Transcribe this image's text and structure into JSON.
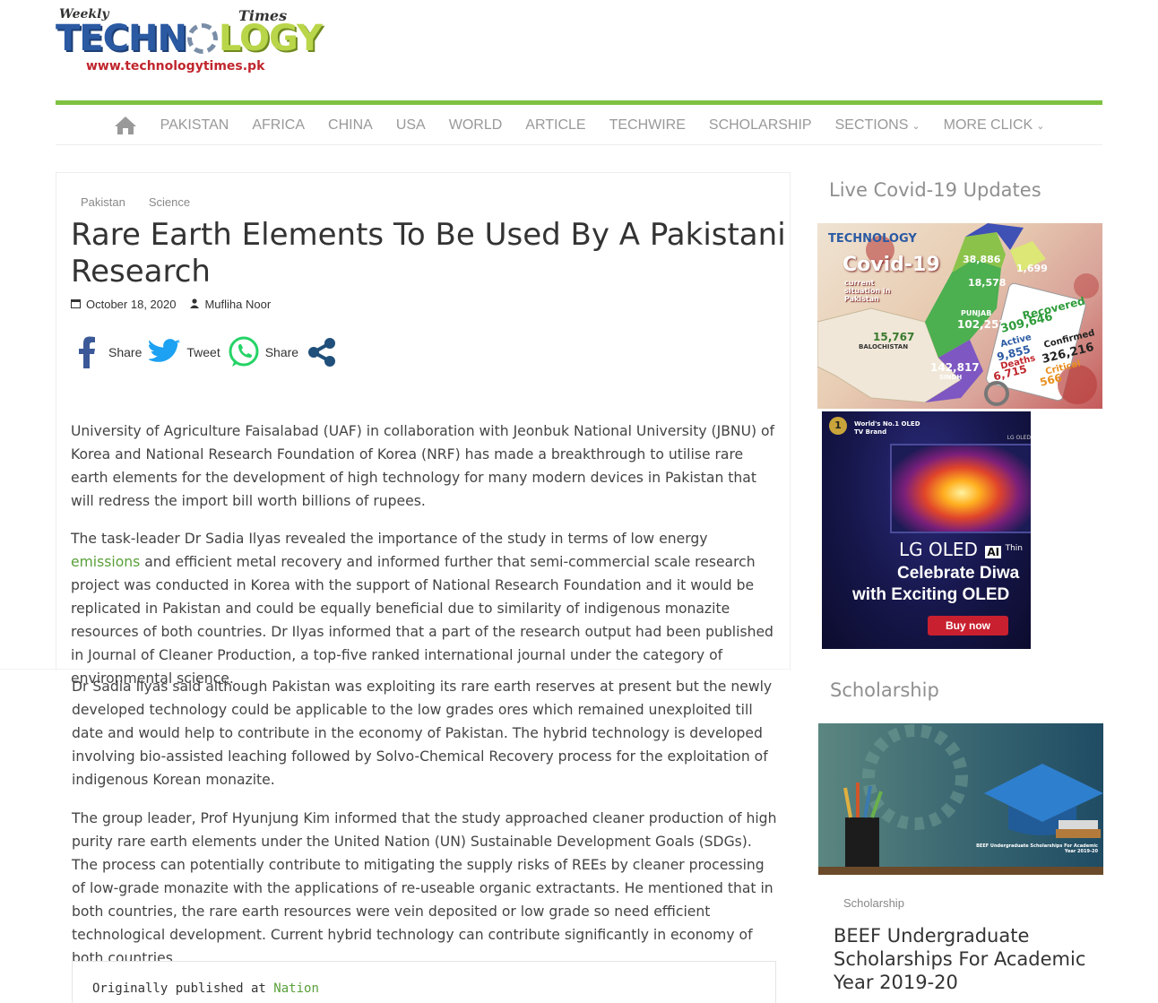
{
  "logo": {
    "weekly": "Weekly",
    "word_start": "TECHN",
    "word_end": "LOGY",
    "times": "Times",
    "url": "www.technologytimes.pk"
  },
  "nav": {
    "items": [
      {
        "label": "PAKISTAN"
      },
      {
        "label": "AFRICA"
      },
      {
        "label": "CHINA"
      },
      {
        "label": "USA"
      },
      {
        "label": "WORLD"
      },
      {
        "label": "ARTICLE"
      },
      {
        "label": "TECHWIRE"
      },
      {
        "label": "SCHOLARSHIP"
      },
      {
        "label": "SECTIONS",
        "caret": "⌄"
      },
      {
        "label": "MORE CLICK",
        "caret": "⌄"
      }
    ]
  },
  "article": {
    "categories": [
      "Pakistan",
      "Science"
    ],
    "title": "Rare Earth Elements To Be Used By A Pakistani Research",
    "date": "October 18, 2020",
    "author": "Mufliha Noor",
    "share": {
      "facebook_label": "Share",
      "twitter_label": "Tweet",
      "whatsapp_label": "Share"
    },
    "p1": "University of Agriculture Faisalabad (UAF) in collaboration with Jeonbuk National University (JBNU) of Korea and National Research Foundation of Korea (NRF) has made a breakthrough to utilise rare earth elements for the development of high technology for many modern devices in Pakistan that will redress the import bill worth billions of rupees.",
    "p2_before": "The task-leader Dr Sadia Ilyas revealed the importance of the study in terms of low energy ",
    "p2_link": "emissions",
    "p2_after": " and efficient metal recovery and informed further that semi-commercial scale research project was conducted in Korea with the support of National Research Foundation and it would be replicated in Pakistan and could be equally beneficial due to similarity of indigenous monazite resources of both countries. Dr Ilyas informed that a part of the research output had been published in Journal of Cleaner Production, a top-five ranked international journal under the category of environmental science.",
    "p3": "Dr Sadia Ilyas said although Pakistan was exploiting its rare earth reserves at present but the newly developed technology could be applicable to the low grades ores which remained unexploited till date and would help to contribute in the economy of Pakistan. The hybrid technology is developed involving bio-assisted leaching followed by Solvo-Chemical Recovery process for the exploitation of indigenous Korean monazite.",
    "p4": "The group leader, Prof Hyunjung Kim informed that the study approached cleaner production of high purity rare earth elements under the United Nation (UN) Sustainable Development Goals (SDGs). The process can potentially contribute to mitigating the supply risks of REEs by cleaner processing of low-grade monazite with the applications of re-useable organic extractants. He mentioned that in both countries, the rare earth resources were vein deposited or low grade so need efficient technological development. Current hybrid technology can contribute significantly in economy of both countries.",
    "published_prefix": "Originally published at ",
    "published_link": "Nation"
  },
  "sidebar": {
    "covid_title": "Live Covid-19 Updates",
    "covid_graphic": {
      "brand": "TECHNOLOGY",
      "headline": "Covid-19",
      "sub": "current situation in Pakistan",
      "recovered": "Recovered",
      "recovered_value": "309,646",
      "active": "Active",
      "active_value": "9,855",
      "deaths": "Deaths",
      "deaths_value": "6,715",
      "confirmed": "Confirmed",
      "confirmed_value": "326,216",
      "critical": "Critical",
      "critical_value": "566",
      "punjab": "PUNJAB",
      "punjab_value": "102,253",
      "sindh": "SINDH",
      "sindh_value": "142,817",
      "balochistan": "BALOCHISTAN",
      "balochistan_value": "15,767",
      "kp_value": "38,886",
      "gb_value": "18,578",
      "ajk_value": "1,699"
    },
    "ad": {
      "badge": "World's No.1 OLED TV Brand",
      "corner": "LG OLED",
      "brand": "LG OLED",
      "ai": "AI",
      "thin": "Thin",
      "line1": "Celebrate Diwa",
      "line2": "with Exciting OLED",
      "cta": "Buy now"
    },
    "scholarship_title": "Scholarship",
    "scholarship_image": {
      "caption": "BEEF Undergraduate Scholarships For Academic Year 2019-20"
    },
    "post": {
      "category": "Scholarship",
      "title": "BEEF Undergraduate Scholarships For Academic Year 2019-20"
    }
  },
  "colors": {
    "accent_green": "#7fc241",
    "link_green": "#5aa03a",
    "logo_blue": "#2b5aa3",
    "logo_red": "#c0262d",
    "facebook": "#3b5998",
    "twitter": "#1da1f2",
    "whatsapp": "#25d366",
    "share_generic": "#1f4f7a"
  },
  "icons": [
    "home-icon",
    "calendar-icon",
    "user-icon",
    "facebook-icon",
    "twitter-icon",
    "whatsapp-icon",
    "share-icon",
    "chevron-down-icon"
  ]
}
